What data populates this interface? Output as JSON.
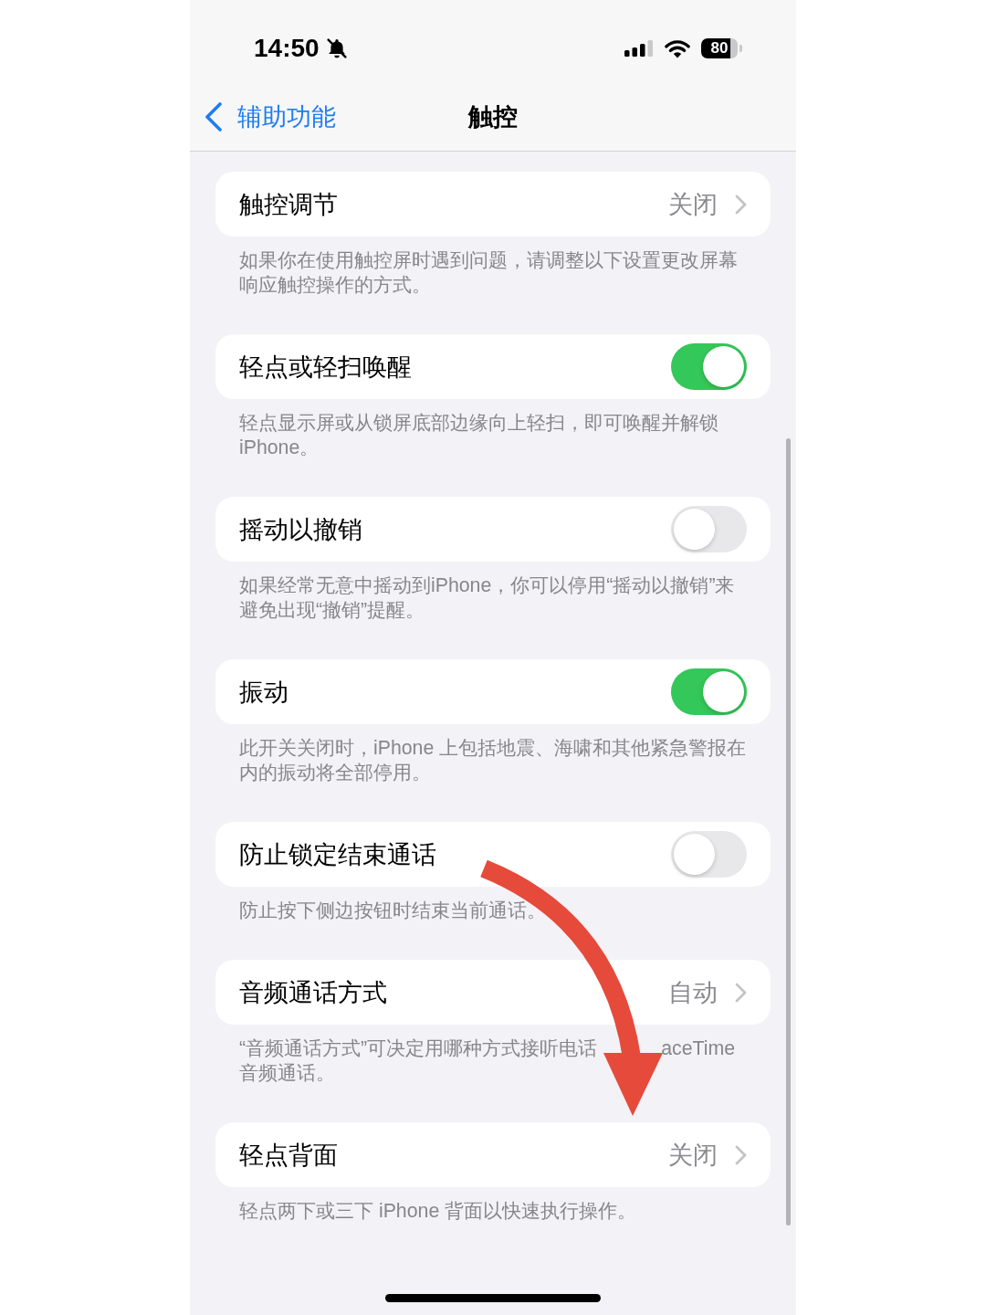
{
  "status_bar": {
    "time": "14:50",
    "silent": true,
    "battery": "80"
  },
  "nav": {
    "back": "辅助功能",
    "title": "触控"
  },
  "groups": [
    {
      "kind": "link",
      "label": "触控调节",
      "value": "关闭",
      "footer": [
        "如果你在使用触控屏时遇到问题，请调整以下设置更改屏幕响应触控操作的方式。"
      ]
    },
    {
      "kind": "switch",
      "label": "轻点或轻扫唤醒",
      "on": true,
      "footer": [
        "轻点显示屏或从锁屏底部边缘向上轻扫，即可唤醒并解锁 iPhone。"
      ]
    },
    {
      "kind": "switch",
      "label": "摇动以撤销",
      "on": false,
      "footer": [
        "如果经常无意中摇动到iPhone，你可以停用“摇动以撤销”来避免出现“撤销”提醒。"
      ]
    },
    {
      "kind": "switch",
      "label": "振动",
      "on": true,
      "footer": [
        "此开关关闭时，iPhone 上包括地震、海啸和其他紧急警报在内的振动将全部停用。"
      ]
    },
    {
      "kind": "switch",
      "label": "防止锁定结束通话",
      "on": false,
      "footer": [
        "防止按下侧边按钮时结束当前通话。"
      ]
    },
    {
      "kind": "link",
      "label": "音频通话方式",
      "value": "自动",
      "footer": [
        "“音频通话方式”可决定用哪种方式接听电话",
        "aceTime音频通话。"
      ]
    },
    {
      "kind": "link",
      "label": "轻点背面",
      "value": "关闭",
      "footer": [
        "轻点两下或三下 iPhone 背面以快速执行操作。"
      ]
    }
  ]
}
